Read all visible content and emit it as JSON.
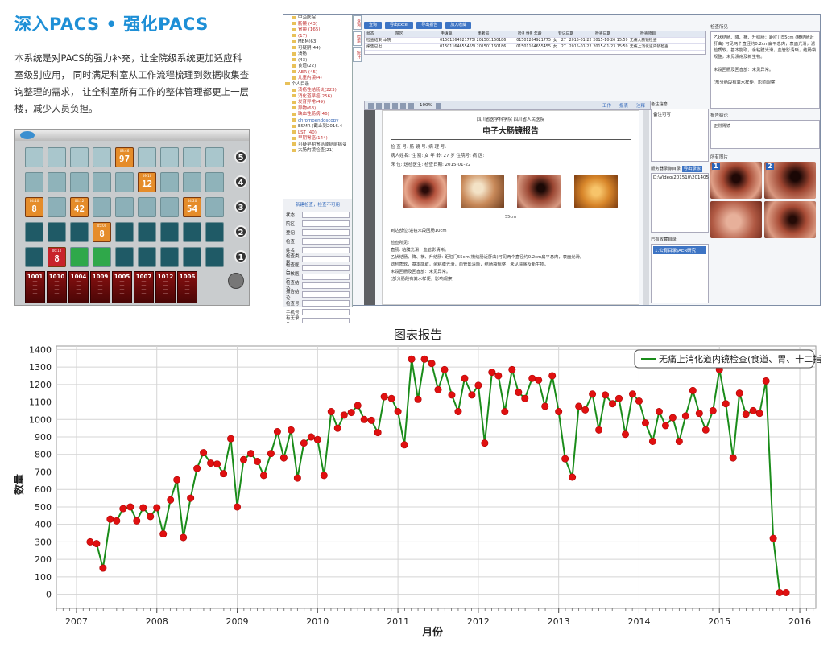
{
  "heading": "深入PACS • 强化PACS",
  "description": "本系统是对PACS的强力补充，让全院级系统更加适应科室级别应用， 同时满足科室从工作流程梳理到数据收集查询整理的需求， 让全科室所有工作的整体管理都更上一层楼，减少人员负担。",
  "queue_panel": {
    "row_badges": [
      "5",
      "4",
      "3",
      "2",
      "1"
    ],
    "highlight_cells": [
      {
        "row": 0,
        "col": 4,
        "time": "08:46",
        "num": "97",
        "color": "#e58c2a"
      },
      {
        "row": 1,
        "col": 5,
        "time": "09:10",
        "num": "12",
        "color": "#e58c2a"
      },
      {
        "row": 2,
        "col": 0,
        "time": "04:10",
        "num": "8",
        "color": "#e58c2a"
      },
      {
        "row": 2,
        "col": 2,
        "time": "04:12",
        "num": "42",
        "color": "#e58c2a"
      },
      {
        "row": 2,
        "col": 7,
        "time": "04:20",
        "num": "54",
        "color": "#e58c2a"
      },
      {
        "row": 3,
        "col": 3,
        "time": "05:00",
        "num": "8",
        "color": "#e58c2a"
      },
      {
        "row": 4,
        "col": 1,
        "time": "06:10",
        "num": "8",
        "color": "#c8222a"
      }
    ],
    "cards": [
      "1001",
      "1010",
      "1004",
      "1009",
      "1005",
      "1007",
      "1012",
      "1006"
    ]
  },
  "pacs": {
    "tree_items": [
      {
        "label": "中沿医院",
        "cls": ""
      },
      {
        "label": "肠镜 (43)",
        "cls": "red"
      },
      {
        "label": "胃镜 (165)",
        "cls": "red"
      },
      {
        "label": "(17)",
        "cls": "red"
      },
      {
        "label": "MBM(63)",
        "cls": ""
      },
      {
        "label": "可疑阴(44)",
        "cls": ""
      },
      {
        "label": "溃疡",
        "cls": ""
      },
      {
        "label": "(43)",
        "cls": ""
      },
      {
        "label": "食道(22)",
        "cls": ""
      },
      {
        "label": "AER (45)",
        "cls": "red"
      },
      {
        "label": "儿童内镜(4)",
        "cls": "red"
      },
      {
        "label": "个人目录",
        "cls": ""
      },
      {
        "label": "溃疡性结肠炎(223)",
        "cls": "red"
      },
      {
        "label": "消化道早癌(256)",
        "cls": "red"
      },
      {
        "label": "发育异常(49)",
        "cls": "red"
      },
      {
        "label": "异物(63)",
        "cls": "red"
      },
      {
        "label": "缺血性肠病(46)",
        "cls": "red"
      },
      {
        "label": "chromoendoscopy",
        "cls": "blue"
      },
      {
        "label": "ESMR (截止到2016.4",
        "cls": ""
      },
      {
        "label": "LST (40)",
        "cls": "red"
      },
      {
        "label": "早期胃癌(144)",
        "cls": "red"
      },
      {
        "label": "可疑早期胃癌或癌前病变",
        "cls": ""
      },
      {
        "label": "大肠内镜检查(21)",
        "cls": ""
      }
    ],
    "filter_link": "新建检查，检查不可用",
    "filter_rows": [
      "状态",
      "院区",
      "登记",
      "检查",
      "姓名",
      "检查类型",
      "检查医生",
      "审核医生",
      "检查结论",
      "报告结论",
      "检查号",
      "手机号",
      "有无录像"
    ],
    "vtabs": [
      "查询",
      "检索",
      "统计"
    ],
    "toolbar": [
      "查询",
      "导出Excel",
      "导出报告",
      "加入收藏"
    ],
    "table_headers": [
      "状态",
      "院区",
      "申请单",
      "患者号",
      "检查号",
      "性别",
      "年龄",
      "登记日期",
      "检查日期",
      "检查项目"
    ],
    "table_rows": [
      [
        "检查结束 本院",
        "0150126492177502",
        "201501160186",
        "01501264921775",
        "女",
        "27",
        "2015-01-22",
        "2015-10-26 15:59",
        "无痛大肠镜检查"
      ],
      [
        "报告已出",
        "0150116465545502",
        "201501160186",
        "01501164655455",
        "女",
        "27",
        "2015-01-22",
        "2015-01-23 15:59",
        "无痛上消化道内镜检查"
      ]
    ],
    "report_toolbar": [
      "工作",
      "报表",
      "注释"
    ],
    "zoom": "100%",
    "report": {
      "hospital": "四川省医学科学院 四川省人民医院",
      "title": "电子大肠镜报告",
      "lines": [
        "检 查 号:                 肠 镜 号:          病 理 号:",
        "病人姓名:          性 别: 女    年 龄: 27 岁    住院号:          病 区:",
        "床     位:                    送检医生:               检查日期: 2015-01-22"
      ],
      "caption": "55cm",
      "text": [
        "到达部位:进镜末段回肠10cm",
        "",
        "检查所见:",
        "直肠: 粘膜光滑，血管影清晰。",
        "乙状结肠、降、横、升结肠: 距肛门55cm(横结肠近肝曲)可见两个直径约0.2cm扁平息肉，表面光滑。",
        "滤检质软，基本能取，余粘膜光滑，血管影清晰，结肠袋规整，未见溃疡及新生物。",
        "末段回肠及回盲部：未见异常。",
        "(部分肠段有粪水样便，影响观察)"
      ]
    },
    "mid_labels": [
      "备注信息",
      "备注可写",
      "服务器录像目录",
      "导出录像",
      "D:\\Video\\201510\\201405",
      "已有收藏目录",
      "1.公有目录\\AER研究"
    ],
    "right_labels": [
      "检查所见",
      "报告结论",
      "所有图片"
    ],
    "findings_text": "乙状结肠、降、横、升结肠：距肛门55cm (横结肠近肝曲) 可见两个直径约0.2cm扁平息肉，表面光滑，滤检质软，基本能取，余粘膜光滑，血管影清晰，结肠袋规整，未见溃疡及新生物。\n\n末段回肠及回盲部：未见异常。\n\n(部分肠段有粪水样便，影响观察)",
    "conclusion_text": "正常胃镜",
    "thumb_labels": [
      "1",
      "2"
    ]
  },
  "chart_data": {
    "type": "line",
    "title": "图表报告",
    "xlabel": "月份",
    "ylabel": "数量",
    "ylim": [
      -80,
      1420
    ],
    "xlim": [
      2006.75,
      2016.2
    ],
    "yticks": [
      0,
      100,
      200,
      300,
      400,
      500,
      600,
      700,
      800,
      900,
      1000,
      1100,
      1200,
      1300,
      1400
    ],
    "xticks": [
      2007,
      2008,
      2009,
      2010,
      2011,
      2012,
      2013,
      2014,
      2015,
      2016
    ],
    "grid": true,
    "legend": "top-right",
    "series": [
      {
        "name": "无痛上消化道内镜检查(食道、胃、十二指肠)",
        "line_color": "#1a8c1a",
        "marker_color": "#e01010",
        "x": [
          2007.17,
          2007.25,
          2007.33,
          2007.42,
          2007.5,
          2007.58,
          2007.67,
          2007.75,
          2007.83,
          2007.92,
          2008.0,
          2008.08,
          2008.17,
          2008.25,
          2008.33,
          2008.42,
          2008.5,
          2008.58,
          2008.67,
          2008.75,
          2008.83,
          2008.92,
          2009.0,
          2009.08,
          2009.17,
          2009.25,
          2009.33,
          2009.42,
          2009.5,
          2009.58,
          2009.67,
          2009.75,
          2009.83,
          2009.92,
          2010.0,
          2010.08,
          2010.17,
          2010.25,
          2010.33,
          2010.42,
          2010.5,
          2010.58,
          2010.67,
          2010.75,
          2010.83,
          2010.92,
          2011.0,
          2011.08,
          2011.17,
          2011.25,
          2011.33,
          2011.42,
          2011.5,
          2011.58,
          2011.67,
          2011.75,
          2011.83,
          2011.92,
          2012.0,
          2012.08,
          2012.17,
          2012.25,
          2012.33,
          2012.42,
          2012.5,
          2012.58,
          2012.67,
          2012.75,
          2012.83,
          2012.92,
          2013.0,
          2013.08,
          2013.17,
          2013.25,
          2013.33,
          2013.42,
          2013.5,
          2013.58,
          2013.67,
          2013.75,
          2013.83,
          2013.92,
          2014.0,
          2014.08,
          2014.17,
          2014.25,
          2014.33,
          2014.42,
          2014.5,
          2014.58,
          2014.67,
          2014.75,
          2014.83,
          2014.92,
          2015.0,
          2015.08,
          2015.17,
          2015.25,
          2015.33,
          2015.42,
          2015.5,
          2015.58,
          2015.67,
          2015.75,
          2015.83
        ],
        "values": [
          300,
          290,
          150,
          430,
          420,
          490,
          500,
          420,
          495,
          445,
          495,
          345,
          540,
          655,
          325,
          550,
          720,
          810,
          750,
          745,
          690,
          890,
          500,
          770,
          805,
          760,
          680,
          805,
          930,
          780,
          940,
          665,
          865,
          900,
          885,
          680,
          1045,
          950,
          1025,
          1040,
          1080,
          1000,
          995,
          925,
          1130,
          1120,
          1045,
          855,
          1345,
          1115,
          1345,
          1320,
          1170,
          1285,
          1140,
          1045,
          1235,
          1140,
          1195,
          865,
          1270,
          1250,
          1045,
          1285,
          1155,
          1120,
          1235,
          1225,
          1075,
          1250,
          1045,
          775,
          670,
          1075,
          1055,
          1145,
          940,
          1140,
          1090,
          1120,
          915,
          1145,
          1105,
          980,
          875,
          1045,
          965,
          1010,
          875,
          1020,
          1165,
          1035,
          940,
          1050,
          1285,
          1090,
          780,
          1150,
          1030,
          1050,
          1035,
          1220,
          320,
          10,
          10
        ]
      }
    ]
  }
}
